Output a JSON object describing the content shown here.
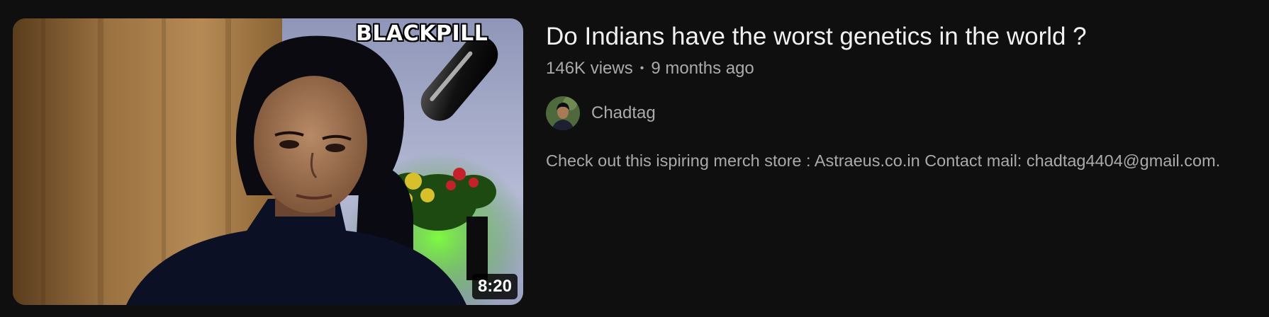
{
  "video": {
    "thumbnail_text": "BLACKPILL",
    "duration": "8:20",
    "title": "Do Indians have the worst genetics in the world ?",
    "views": "146K views",
    "separator": "•",
    "age": "9 months ago",
    "channel_name": "Chadtag",
    "description": "Check out this ispiring merch store : Astraeus.co.in Contact mail: chadtag4404@gmail.com."
  },
  "colors": {
    "background": "#0f0f0f",
    "title": "#f1f1f1",
    "secondary_text": "#aaaaaa"
  }
}
